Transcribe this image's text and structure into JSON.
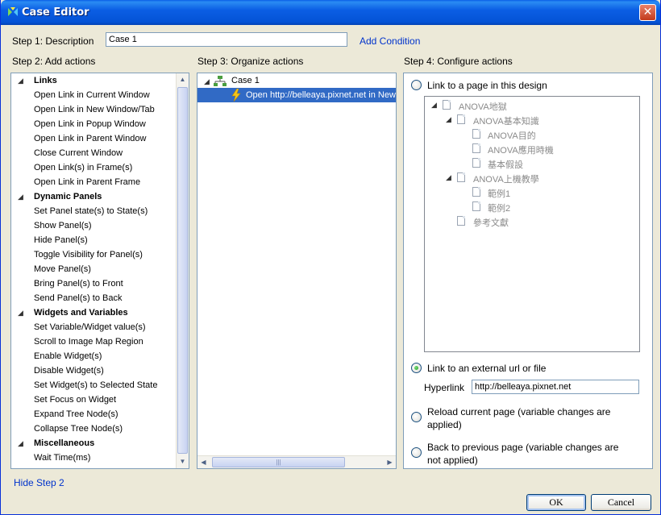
{
  "window": {
    "title": "Case Editor",
    "close_glyph": "✕"
  },
  "step1": {
    "label": "Step 1: Description",
    "value": "Case 1",
    "add_condition": "Add Condition"
  },
  "step2": {
    "label": "Step 2: Add actions",
    "groups": [
      {
        "name": "Links",
        "items": [
          "Open Link in Current Window",
          "Open Link in New Window/Tab",
          "Open Link in Popup Window",
          "Open Link in Parent Window",
          "Close Current Window",
          "Open Link(s) in Frame(s)",
          "Open Link in Parent Frame"
        ]
      },
      {
        "name": "Dynamic Panels",
        "items": [
          "Set Panel state(s) to State(s)",
          "Show Panel(s)",
          "Hide Panel(s)",
          "Toggle Visibility for Panel(s)",
          "Move Panel(s)",
          "Bring Panel(s) to Front",
          "Send Panel(s) to Back"
        ]
      },
      {
        "name": "Widgets and Variables",
        "items": [
          "Set Variable/Widget value(s)",
          "Scroll to Image Map Region",
          "Enable Widget(s)",
          "Disable Widget(s)",
          "Set Widget(s) to Selected State",
          "Set Focus on Widget",
          "Expand Tree Node(s)",
          "Collapse Tree Node(s)"
        ]
      },
      {
        "name": "Miscellaneous",
        "items": [
          "Wait Time(ms)"
        ]
      }
    ],
    "hide_link": "Hide Step 2"
  },
  "step3": {
    "label": "Step 3: Organize actions",
    "case_name": "Case 1",
    "action": "Open http://belleaya.pixnet.net in New"
  },
  "step4": {
    "label": "Step 4: Configure actions",
    "opt_page": "Link to a page in this design",
    "tree": {
      "root": "ANOVA地獄",
      "n1": "ANOVA基本知識",
      "n1a": "ANOVA目的",
      "n1b": "ANOVA應用時機",
      "n1c": "基本假設",
      "n2": "ANOVA上機教學",
      "n2a": "範例1",
      "n2b": "範例2",
      "n3": "參考文獻"
    },
    "opt_external": "Link to an external url or file",
    "hyperlink_label": "Hyperlink",
    "hyperlink_value": "http://belleaya.pixnet.net",
    "opt_reload_1": "Reload current page (variable changes are",
    "opt_reload_2": "applied)",
    "opt_back_1": "Back to previous page (variable changes are",
    "opt_back_2": "not applied)",
    "selected_option": "external"
  },
  "buttons": {
    "ok": "OK",
    "cancel": "Cancel"
  },
  "colors": {
    "title_bar": "#0453d6",
    "selection": "#316ac5",
    "link": "#0033cc"
  }
}
